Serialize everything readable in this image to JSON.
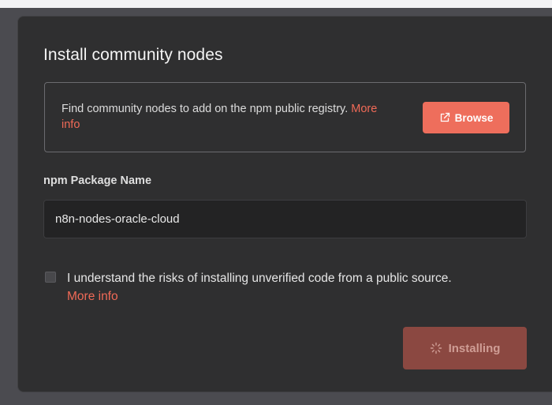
{
  "dialog": {
    "title": "Install community nodes",
    "info": {
      "text": "Find community nodes to add on the npm public registry. ",
      "link": "More info",
      "browse_label": "Browse",
      "browse_icon": "external-link-icon"
    },
    "package": {
      "label": "npm Package Name",
      "value": "n8n-nodes-oracle-cloud"
    },
    "consent": {
      "text": "I understand the risks of installing unverified code from a public source.",
      "link": "More info",
      "checked": false
    },
    "install": {
      "label": "Installing",
      "icon": "spinner-icon",
      "state": "disabled"
    }
  },
  "colors": {
    "accent": "#ee6e5c",
    "link": "#f06a57",
    "dialog_bg": "#2f2f30",
    "backdrop": "#4b4b50"
  }
}
